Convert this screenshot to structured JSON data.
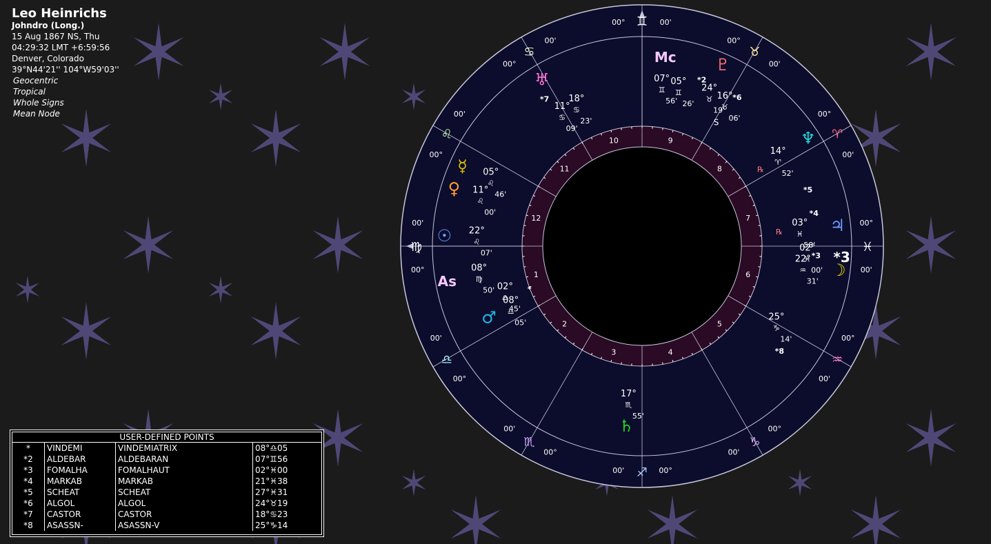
{
  "header": {
    "name": "Leo Heinrichs",
    "system": "Johndro (Long.)",
    "date": "15 Aug 1867 NS, Thu",
    "time": "04:29:32  LMT +6:59:56",
    "place": "Denver, Colorado",
    "coords": "39°N44'21'' 104°W59'03''",
    "options": [
      "Geocentric",
      "Tropical",
      "Whole Signs",
      "Mean Node"
    ]
  },
  "points_table": {
    "title": "USER-DEFINED POINTS",
    "rows": [
      {
        "mark": "*",
        "short": "VINDEMI",
        "full": "VINDEMIATRIX",
        "pos": "08°♎05"
      },
      {
        "mark": "*2",
        "short": "ALDEBAR",
        "full": "ALDEBARAN",
        "pos": "07°♊56"
      },
      {
        "mark": "*3",
        "short": "FOMALHA",
        "full": "FOMALHAUT",
        "pos": "02°♓00"
      },
      {
        "mark": "*4",
        "short": "MARKAB",
        "full": "MARKAB",
        "pos": "21°♓38"
      },
      {
        "mark": "*5",
        "short": "SCHEAT",
        "full": "SCHEAT",
        "pos": "27°♓31"
      },
      {
        "mark": "*6",
        "short": "ALGOL",
        "full": "ALGOL",
        "pos": "24°♉19"
      },
      {
        "mark": "*7",
        "short": "CASTOR",
        "full": "CASTOR",
        "pos": "18°♋23"
      },
      {
        "mark": "*8",
        "short": "ASASSN-",
        "full": "ASASSN-V",
        "pos": "25°♑14"
      }
    ]
  },
  "wheel": {
    "colors": {
      "background": "#0c0c2c",
      "house_ring": "#2a0a24",
      "lines": "#c8c8dc"
    },
    "cusps": [
      {
        "glyph": "♊",
        "color": "#ffffff",
        "deg_a": "00°",
        "deg_b": "00'"
      },
      {
        "glyph": "♉",
        "color": "#ffe9a0",
        "deg_a": "00°",
        "deg_b": "00'"
      },
      {
        "glyph": "♈",
        "color": "#ff6b8a",
        "deg_a": "00°",
        "deg_b": "00'"
      },
      {
        "glyph": "♓",
        "color": "#ffffff",
        "deg_a": "00°",
        "deg_b": "00'"
      },
      {
        "glyph": "♒",
        "color": "#ff80c8",
        "deg_a": "00°",
        "deg_b": "00'"
      },
      {
        "glyph": "♑",
        "color": "#e0b8ff",
        "deg_a": "00°",
        "deg_b": "00'"
      },
      {
        "glyph": "♐",
        "color": "#a8c8ff",
        "deg_a": "00°",
        "deg_b": "00'"
      },
      {
        "glyph": "♏",
        "color": "#c8a0ff",
        "deg_a": "00°",
        "deg_b": "00'"
      },
      {
        "glyph": "♎",
        "color": "#a8f0ff",
        "deg_a": "00°",
        "deg_b": "00'"
      },
      {
        "glyph": "♍",
        "color": "#ffffff",
        "deg_a": "00°",
        "deg_b": "00'"
      },
      {
        "glyph": "♌",
        "color": "#c8ffb0",
        "deg_a": "00°",
        "deg_b": "00'"
      },
      {
        "glyph": "♋",
        "color": "#e8ffd0",
        "deg_a": "00°",
        "deg_b": "00'"
      }
    ],
    "houses": [
      "1",
      "2",
      "3",
      "4",
      "5",
      "6",
      "7",
      "8",
      "9",
      "10",
      "11",
      "12"
    ],
    "planets": [
      {
        "name": "mc",
        "glyph": "Mc",
        "color": "#f8c8ff",
        "deg": "07°",
        "sign": "♊",
        "min": "56'",
        "deg2": "05°",
        "sign2": "♊",
        "min2": "26'"
      },
      {
        "name": "pluto",
        "glyph": "♇",
        "color": "#ff7070",
        "deg": "24°",
        "sign": "♉",
        "min": "19'",
        "deg2": "16°",
        "sign2": "♉",
        "min2": "06'",
        "note": "S"
      },
      {
        "name": "neptune",
        "glyph": "♆",
        "color": "#20d8d8",
        "deg": "14°",
        "sign": "♈",
        "min": "52'",
        "retro": "℞"
      },
      {
        "name": "jupiter",
        "glyph": "♃",
        "color": "#6aa0ff",
        "deg": "03°",
        "sign": "♓",
        "min": "58'",
        "retro": "℞"
      },
      {
        "name": "fomalhaut",
        "glyph": "*3",
        "color": "#ffffff",
        "deg": "02°",
        "sign": "♓",
        "min": "00'"
      },
      {
        "name": "moon",
        "glyph": "☽",
        "color": "#f0e000",
        "deg": "22°",
        "sign": "♒",
        "min": "31'"
      },
      {
        "name": "node",
        "glyph": "",
        "color": "#ffffff",
        "deg": "25°",
        "sign": "♑",
        "min": "14'"
      },
      {
        "name": "saturn",
        "glyph": "♄",
        "color": "#20d820",
        "deg": "17°",
        "sign": "♏",
        "min": "55'"
      },
      {
        "name": "mars",
        "glyph": "♂",
        "color": "#20b8e8",
        "deg": "08°",
        "sign": "♎",
        "min": "05'",
        "deg2": "02°",
        "sign2": "♎",
        "min2": "45'"
      },
      {
        "name": "asc",
        "glyph": "As",
        "color": "#f8c8ff",
        "deg": "08°",
        "sign": "♍",
        "min": "50'"
      },
      {
        "name": "sun",
        "glyph": "☉",
        "color": "#6aa0ff",
        "deg": "22°",
        "sign": "♌",
        "min": "07'"
      },
      {
        "name": "venus",
        "glyph": "♀",
        "color": "#ff9c30",
        "deg": "11°",
        "sign": "♌",
        "min": "00'"
      },
      {
        "name": "mercury",
        "glyph": "☿",
        "color": "#e0c000",
        "deg": "05°",
        "sign": "♌",
        "min": "46'"
      },
      {
        "name": "uranus",
        "glyph": "♅",
        "color": "#ff70d8",
        "deg": "11°",
        "sign": "♋",
        "min": "09'",
        "deg2": "18°",
        "sign2": "♋",
        "min2": "23'"
      }
    ],
    "star_marks": [
      "*2",
      "*6",
      "*7",
      "*5",
      "*4",
      "*3",
      "*8",
      "*"
    ]
  }
}
